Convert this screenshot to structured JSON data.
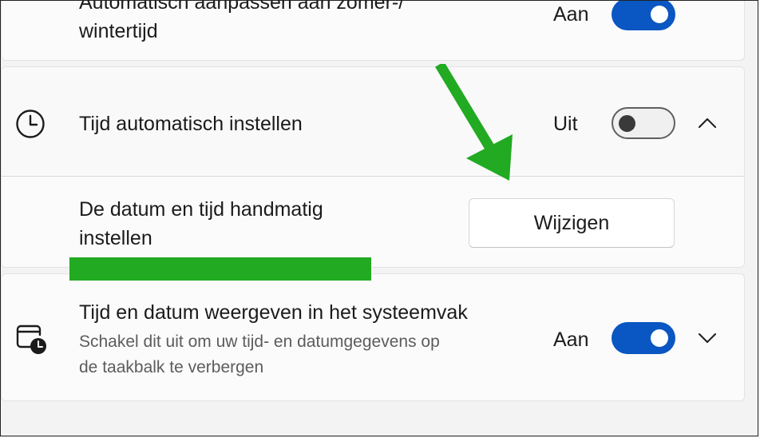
{
  "settings": {
    "auto_dst": {
      "label_line1": "Automatisch aanpassen aan zomer-/",
      "label_line2": "wintertijd",
      "state": "Aan",
      "on": true
    },
    "auto_time": {
      "label": "Tijd automatisch instellen",
      "state": "Uit",
      "on": false,
      "expanded": true,
      "icon": "clock-icon"
    },
    "manual": {
      "label_line1": "De datum en tijd handmatig",
      "label_line2": "instellen",
      "button_label": "Wijzigen"
    },
    "systray": {
      "label": "Tijd en datum weergeven in het systeemvak",
      "description_line1": "Schakel dit uit om uw tijd- en datumgegevens op",
      "description_line2": "de taakbalk te verbergen",
      "state": "Aan",
      "on": true,
      "expanded": false,
      "icon": "calendar-clock-icon"
    }
  },
  "annotations": {
    "arrow_color": "#22aa22",
    "highlight_color": "#22aa22"
  },
  "colors": {
    "accent": "#0a56c2",
    "card_bg": "#fbfbfb",
    "page_bg": "#f3f3f3"
  }
}
